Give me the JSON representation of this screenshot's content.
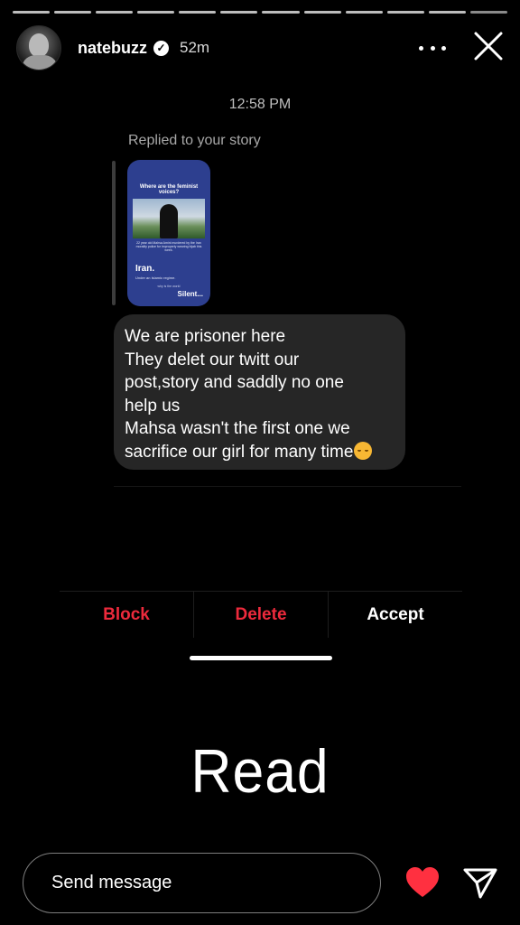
{
  "story": {
    "username": "natebuzz",
    "verified_mark": "✓",
    "posted_ago": "52m",
    "progress_segments": 12,
    "active_segment": 12
  },
  "message": {
    "timestamp": "12:58 PM",
    "replied_label": "Replied to your story",
    "story_preview": {
      "question": "Where are the feminist voices?",
      "caption": "22 year old Mahsa Amini murdered by the Iran morality police for improperly wearing hijab this week.",
      "headline": "Iran.",
      "subline": "Under an Islamic regime.",
      "why": "why is the world",
      "silent": "Silent..."
    },
    "lines": [
      "We are prisoner here",
      "They delet our twitt our",
      "post,story and saddly no one",
      "help us",
      "Mahsa wasn't the first one we",
      "sacrifice our girl for many time"
    ],
    "emoji": "pensive-face"
  },
  "actions": {
    "block": "Block",
    "delete": "Delete",
    "accept": "Accept"
  },
  "overlay_text": "Read",
  "composer": {
    "placeholder": "Send message"
  },
  "colors": {
    "background": "#000000",
    "bubble": "#262626",
    "danger": "#ed2a3c",
    "heart": "#ff3040",
    "story_preview_bg": "#2d3f8f"
  },
  "icons": {
    "more": "more-icon",
    "close": "close-icon",
    "like": "heart-icon",
    "share": "send-icon"
  }
}
